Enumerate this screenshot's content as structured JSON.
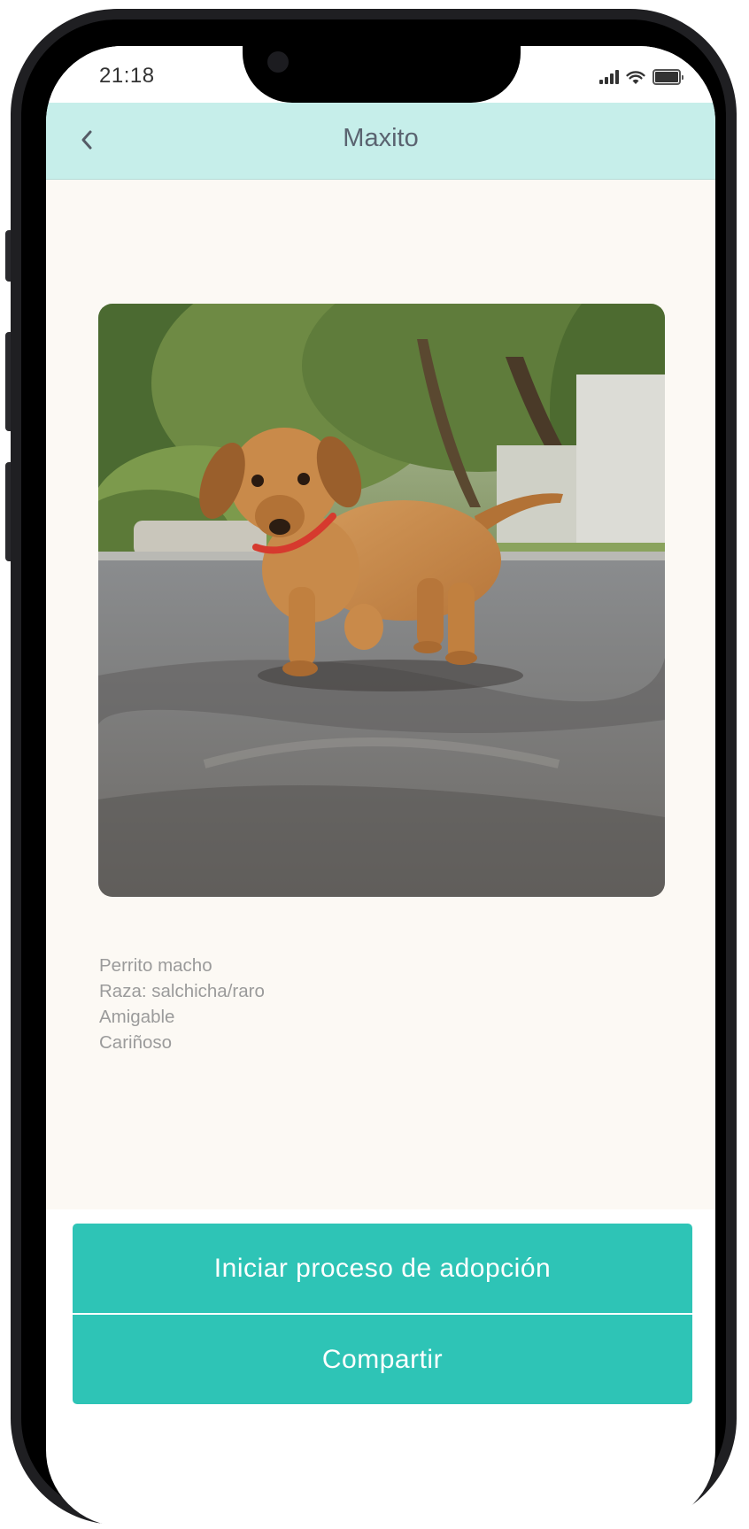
{
  "status_bar": {
    "time": "21:18",
    "icons": [
      "signal-icon",
      "wifi-icon",
      "battery-icon"
    ]
  },
  "nav": {
    "title": "Maxito",
    "back_icon": "chevron-left-icon"
  },
  "pet": {
    "photo": "dog-photo",
    "description": [
      "Perrito macho",
      "Raza: salchicha/raro",
      "Amigable",
      "Cariñoso"
    ]
  },
  "actions": {
    "adopt_label": "Iniciar proceso de adopción",
    "share_label": "Compartir"
  },
  "colors": {
    "header": "#c6eeea",
    "accent": "#2ec4b6",
    "background": "#fcf9f4",
    "description_text": "#9b9b9b"
  }
}
